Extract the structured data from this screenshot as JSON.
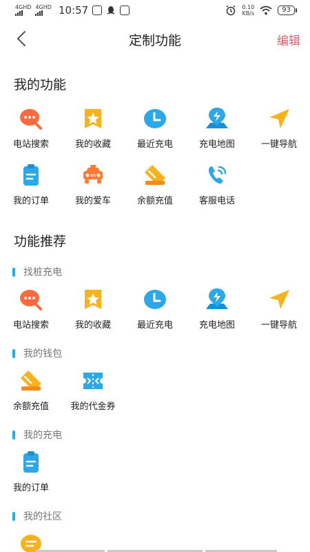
{
  "status_bar": {
    "sim1": "4GHD",
    "sim2": "4GHD",
    "time": "10:57",
    "net_speed_value": "0.10",
    "net_speed_unit": "KB/s",
    "battery": "93"
  },
  "header": {
    "title": "定制功能",
    "edit_label": "编辑"
  },
  "my_functions": {
    "title": "我的功能",
    "items": [
      {
        "label": "电站搜索",
        "icon": "chat-search-icon"
      },
      {
        "label": "我的收藏",
        "icon": "star-icon"
      },
      {
        "label": "最近充电",
        "icon": "clock-icon"
      },
      {
        "label": "充电地图",
        "icon": "map-bolt-icon"
      },
      {
        "label": "一键导航",
        "icon": "navigation-icon"
      },
      {
        "label": "我的订单",
        "icon": "clipboard-icon"
      },
      {
        "label": "我的爱车",
        "icon": "car-icon"
      },
      {
        "label": "余额充值",
        "icon": "card-icon"
      },
      {
        "label": "客服电话",
        "icon": "phone-icon"
      }
    ]
  },
  "recommended": {
    "title": "功能推荐",
    "groups": [
      {
        "title": "找桩充电",
        "items": [
          {
            "label": "电站搜索",
            "icon": "chat-search-icon"
          },
          {
            "label": "我的收藏",
            "icon": "star-icon"
          },
          {
            "label": "最近充电",
            "icon": "clock-icon"
          },
          {
            "label": "充电地图",
            "icon": "map-bolt-icon"
          },
          {
            "label": "一键导航",
            "icon": "navigation-icon"
          }
        ]
      },
      {
        "title": "我的钱包",
        "items": [
          {
            "label": "余额充值",
            "icon": "card-icon"
          },
          {
            "label": "我的代金券",
            "icon": "coupon-icon"
          }
        ]
      },
      {
        "title": "我的充电",
        "items": [
          {
            "label": "我的订单",
            "icon": "clipboard-icon"
          }
        ]
      },
      {
        "title": "我的社区",
        "items": [
          {
            "label": "",
            "icon": "community-chat-icon"
          }
        ]
      }
    ]
  },
  "colors": {
    "accent_red": "#f0566a",
    "accent_blue": "#1ab0f0",
    "orange": "#ff7a33",
    "yellow": "#f9b21b"
  }
}
